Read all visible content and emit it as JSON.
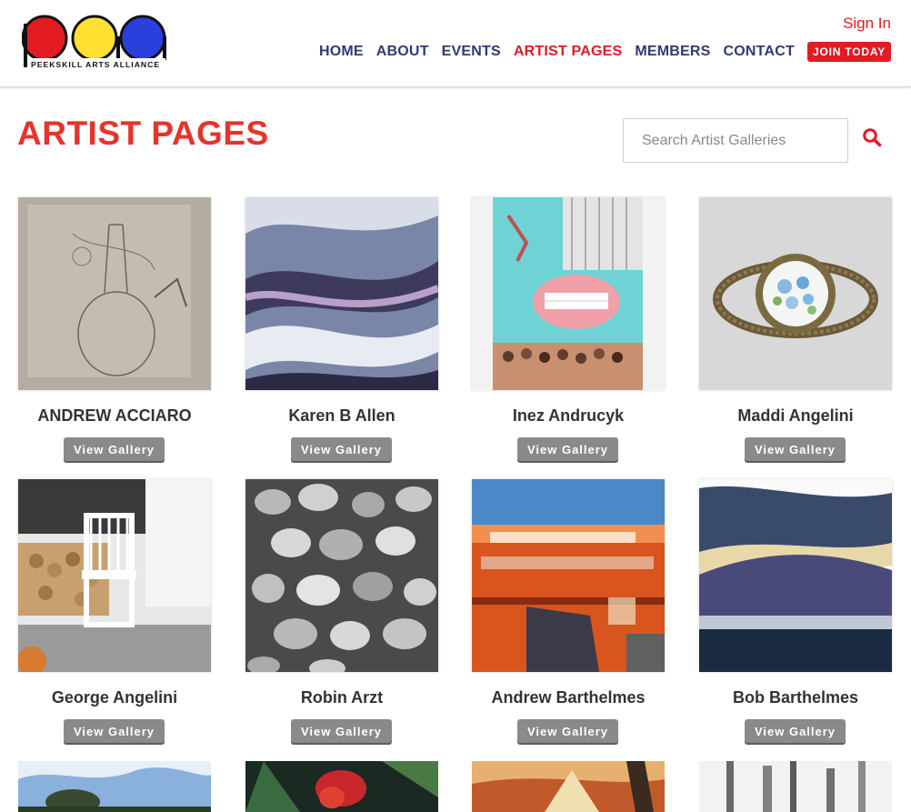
{
  "header": {
    "logo_text": "PEEKSKILL ARTS ALLIANCE",
    "sign_in": "Sign In",
    "nav": [
      "HOME",
      "ABOUT",
      "EVENTS",
      "ARTIST PAGES",
      "MEMBERS",
      "CONTACT"
    ],
    "active_nav": "ARTIST PAGES",
    "join": "JOIN TODAY"
  },
  "page": {
    "title": "ARTIST PAGES",
    "search_placeholder": "Search Artist Galleries"
  },
  "colors": {
    "accent": "#e31b23",
    "nav": "#2e3a78",
    "button": "#8a8a8a"
  },
  "artists": [
    {
      "name": "ANDREW ACCIARO",
      "button": "View Gallery"
    },
    {
      "name": "Karen B Allen",
      "button": "View Gallery"
    },
    {
      "name": "Inez Andrucyk",
      "button": "View Gallery"
    },
    {
      "name": "Maddi Angelini",
      "button": "View Gallery"
    },
    {
      "name": "George Angelini",
      "button": "View Gallery"
    },
    {
      "name": "Robin Arzt",
      "button": "View Gallery"
    },
    {
      "name": "Andrew Barthelmes",
      "button": "View Gallery"
    },
    {
      "name": "Bob Barthelmes",
      "button": "View Gallery"
    }
  ]
}
